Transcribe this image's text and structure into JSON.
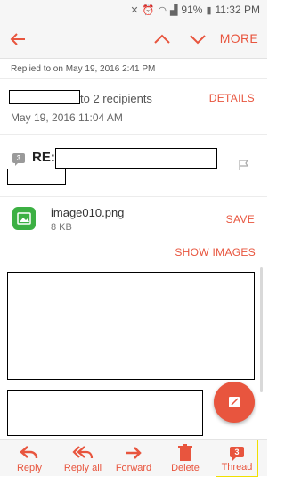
{
  "status": {
    "battery": "91%",
    "time": "11:32 PM"
  },
  "actionbar": {
    "more_label": "MORE"
  },
  "message": {
    "replied_text": "Replied to on May 19, 2016  2:41 PM",
    "to_recipients": "to 2 recipients",
    "details_label": "DETAILS",
    "date": "May 19, 2016  11:04 AM",
    "thread_count": "3",
    "subject_prefix": "RE:"
  },
  "attachment": {
    "name": "image010.png",
    "size": "8 KB",
    "save_label": "SAVE"
  },
  "show_images_label": "SHOW IMAGES",
  "bottom": {
    "reply": "Reply",
    "reply_all": "Reply all",
    "forward": "Forward",
    "delete": "Delete",
    "thread": "Thread",
    "thread_badge": "3"
  },
  "colors": {
    "accent": "#e8553e",
    "attachment": "#3cb043",
    "selection": "#f0e000"
  }
}
